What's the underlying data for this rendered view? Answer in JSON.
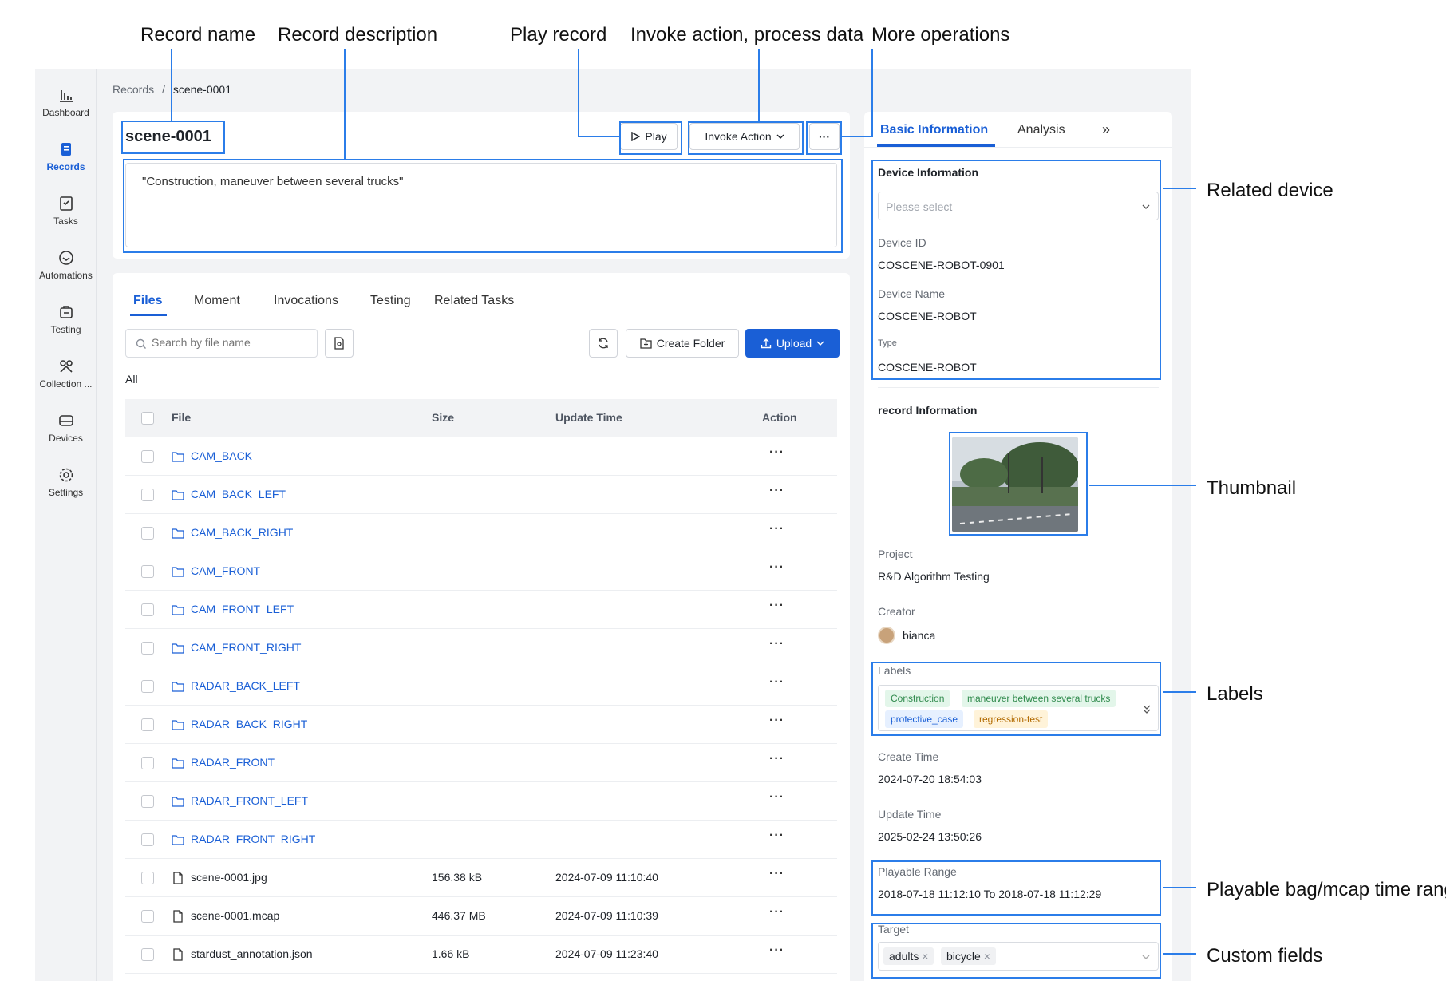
{
  "annotations": {
    "record_name": "Record name",
    "record_description": "Record description",
    "play_record": "Play record",
    "invoke_action": "Invoke action, process data",
    "more_operations": "More operations",
    "related_device": "Related device",
    "thumbnail": "Thumbnail",
    "labels": "Labels",
    "playable_range": "Playable bag/mcap time range",
    "custom_fields": "Custom fields"
  },
  "sidebar": {
    "items": [
      {
        "label": "Dashboard",
        "icon": "bar-chart-icon"
      },
      {
        "label": "Records",
        "icon": "records-icon",
        "active": true
      },
      {
        "label": "Tasks",
        "icon": "tasks-icon"
      },
      {
        "label": "Automations",
        "icon": "automations-icon"
      },
      {
        "label": "Testing",
        "icon": "testing-icon"
      },
      {
        "label": "Collection ...",
        "icon": "collection-icon"
      },
      {
        "label": "Devices",
        "icon": "devices-icon"
      },
      {
        "label": "Settings",
        "icon": "gear-icon"
      }
    ]
  },
  "breadcrumb": {
    "parent": "Records",
    "separator": "/",
    "current": "scene-0001"
  },
  "record": {
    "name": "scene-0001",
    "description": "\"Construction, maneuver between several trucks\"",
    "play_label": "Play",
    "invoke_label": "Invoke Action",
    "more_label": "···"
  },
  "file_tabs": [
    "Files",
    "Moment",
    "Invocations",
    "Testing",
    "Related Tasks"
  ],
  "toolbar": {
    "search_placeholder": "Search by file name",
    "create_folder_label": "Create Folder",
    "upload_label": "Upload",
    "filter_all": "All"
  },
  "table": {
    "columns": [
      "File",
      "Size",
      "Update Time",
      "Action"
    ],
    "rows": [
      {
        "name": "CAM_BACK",
        "type": "folder",
        "size": "",
        "time": ""
      },
      {
        "name": "CAM_BACK_LEFT",
        "type": "folder",
        "size": "",
        "time": ""
      },
      {
        "name": "CAM_BACK_RIGHT",
        "type": "folder",
        "size": "",
        "time": ""
      },
      {
        "name": "CAM_FRONT",
        "type": "folder",
        "size": "",
        "time": ""
      },
      {
        "name": "CAM_FRONT_LEFT",
        "type": "folder",
        "size": "",
        "time": ""
      },
      {
        "name": "CAM_FRONT_RIGHT",
        "type": "folder",
        "size": "",
        "time": ""
      },
      {
        "name": "RADAR_BACK_LEFT",
        "type": "folder",
        "size": "",
        "time": ""
      },
      {
        "name": "RADAR_BACK_RIGHT",
        "type": "folder",
        "size": "",
        "time": ""
      },
      {
        "name": "RADAR_FRONT",
        "type": "folder",
        "size": "",
        "time": ""
      },
      {
        "name": "RADAR_FRONT_LEFT",
        "type": "folder",
        "size": "",
        "time": ""
      },
      {
        "name": "RADAR_FRONT_RIGHT",
        "type": "folder",
        "size": "",
        "time": ""
      },
      {
        "name": "scene-0001.jpg",
        "type": "file",
        "size": "156.38 kB",
        "time": "2024-07-09 11:10:40"
      },
      {
        "name": "scene-0001.mcap",
        "type": "file",
        "size": "446.37 MB",
        "time": "2024-07-09 11:10:39"
      },
      {
        "name": "stardust_annotation.json",
        "type": "file",
        "size": "1.66 kB",
        "time": "2024-07-09 11:23:40"
      }
    ],
    "action_label": "···"
  },
  "right_tabs": [
    "Basic Information",
    "Analysis"
  ],
  "right_more": "»",
  "device": {
    "section_title": "Device Information",
    "select_placeholder": "Please select",
    "id_label": "Device ID",
    "id_value": "COSCENE-ROBOT-0901",
    "name_label": "Device Name",
    "name_value": "COSCENE-ROBOT",
    "type_label": "Type",
    "type_value": "COSCENE-ROBOT"
  },
  "record_info": {
    "section_title": "record Information",
    "project_label": "Project",
    "project_value": "R&D Algorithm Testing",
    "creator_label": "Creator",
    "creator_value": "bianca",
    "labels_label": "Labels",
    "labels": [
      {
        "text": "Construction",
        "bg": "#e3f6ea",
        "fg": "#2f8a4c"
      },
      {
        "text": "maneuver between several trucks",
        "bg": "#e3f6ea",
        "fg": "#2f8a4c"
      },
      {
        "text": "protective_case",
        "bg": "#e6f0ff",
        "fg": "#1a5fd6"
      },
      {
        "text": "regression-test",
        "bg": "#fff3d9",
        "fg": "#b26a00"
      }
    ],
    "create_label": "Create Time",
    "create_value": "2024-07-20 18:54:03",
    "update_label": "Update Time",
    "update_value": "2025-02-24 13:50:26",
    "playable_label": "Playable Range",
    "playable_value": "2018-07-18 11:12:10 To 2018-07-18 11:12:29",
    "target_label": "Target",
    "targets": [
      "adults",
      "bicycle"
    ]
  },
  "colors": {
    "accent": "#1a5fd6",
    "highlight": "#2b7de9"
  }
}
